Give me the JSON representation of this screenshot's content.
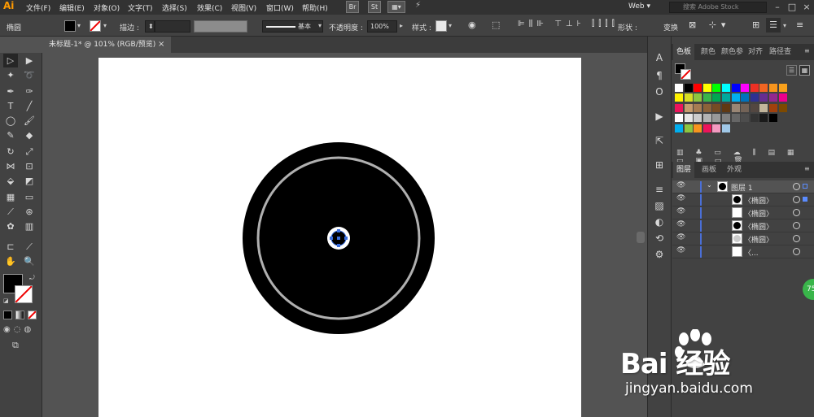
{
  "app": {
    "logo": "Ai",
    "menus": [
      "文件(F)",
      "编辑(E)",
      "对象(O)",
      "文字(T)",
      "选择(S)",
      "效果(C)",
      "视图(V)",
      "窗口(W)",
      "帮助(H)"
    ],
    "bridge": "Br",
    "stock": "St",
    "workspace": "Web",
    "search_placeholder": "搜索 Adobe Stock"
  },
  "control_bar": {
    "object_type": "椭圆",
    "stroke_label": "描边 :",
    "stroke_style": "基本",
    "opacity_label": "不透明度 :",
    "opacity_value": "100%",
    "style_label": "样式 :",
    "shape_label": "形状 :",
    "transform_label": "变换",
    "fill_color": "#000000",
    "stroke_color": "none"
  },
  "document": {
    "tab_title": "未标题-1* @ 101% (RGB/预览)",
    "tab_close": "×"
  },
  "swatches_panel": {
    "tabs": [
      "色板",
      "颜色",
      "颜色参",
      "对齐",
      "路径查"
    ],
    "rows": [
      [
        "#ffffff",
        "#000000",
        "#ff0000",
        "#ffff00",
        "#00ff00",
        "#00ffff",
        "#0000ff",
        "#ff00ff",
        "#ee3024",
        "#f26522",
        "#f7941d",
        "#f9a11b"
      ],
      [
        "#fff200",
        "#d7df23",
        "#8dc63f",
        "#39b54a",
        "#00a651",
        "#00a99d",
        "#00aeef",
        "#0072bc",
        "#2e3192",
        "#662d91",
        "#92278f",
        "#ec008c"
      ],
      [
        "#ed145b",
        "#c69c6d",
        "#a67c52",
        "#8c6239",
        "#754c24",
        "#603913",
        "#998675",
        "#736357",
        "#534741",
        "#c2b59b",
        "#a0410d",
        "#7d4900"
      ],
      [
        "#ffffff",
        "#e6e6e6",
        "#cccccc",
        "#b3b3b3",
        "#999999",
        "#808080",
        "#666666",
        "#4d4d4d",
        "#333333",
        "#1a1a1a",
        "#000000"
      ],
      [
        "#00aeef",
        "#8dc63f",
        "#f7941d",
        "#ed145b",
        "#f49ac1",
        "#a0c8e8"
      ]
    ]
  },
  "layers_panel": {
    "tabs": [
      "图层",
      "画板",
      "外观"
    ],
    "rows": [
      {
        "name": "图层 1",
        "thumb": "#000000"
      },
      {
        "name": "〈椭圆〉",
        "thumb": "#000000"
      },
      {
        "name": "〈椭圆〉",
        "thumb": "#ffffff"
      },
      {
        "name": "〈椭圆〉",
        "thumb": "#000000"
      },
      {
        "name": "〈椭圆〉",
        "thumb": "#cccccc"
      },
      {
        "name": "〈...",
        "thumb": "#ffffff"
      }
    ]
  },
  "watermark": {
    "brand": "Bai  经验",
    "url": "jingyan.baidu.com",
    "badge": "75"
  }
}
